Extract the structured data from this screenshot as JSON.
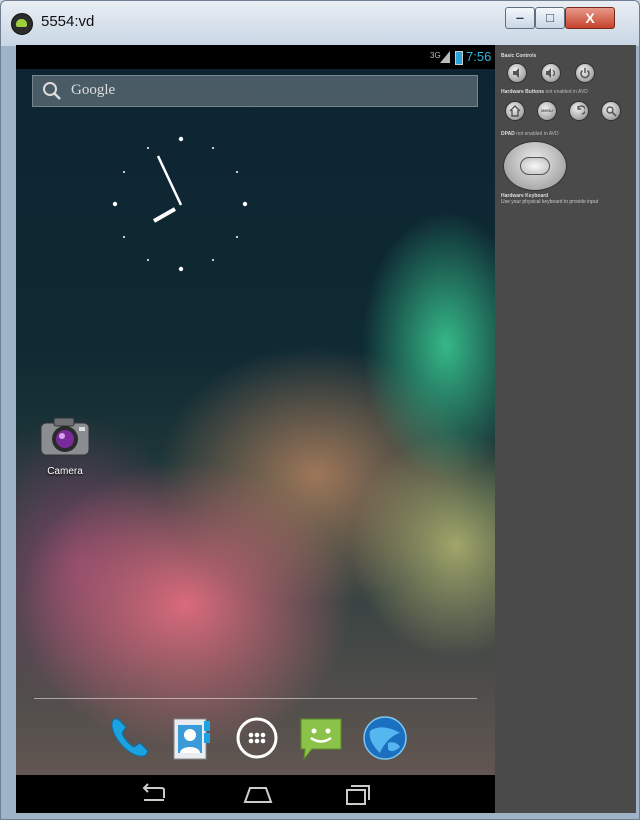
{
  "window": {
    "title": "5554:vd",
    "minimize_glyph": "‒",
    "maximize_glyph": "□",
    "close_glyph": "X"
  },
  "statusbar": {
    "network_type": "3G",
    "time": "7:56"
  },
  "search": {
    "placeholder": "Google"
  },
  "home": {
    "apps": [
      {
        "label": "Camera",
        "icon": "camera-icon"
      }
    ],
    "dock": [
      {
        "icon": "phone-icon"
      },
      {
        "icon": "contacts-icon"
      },
      {
        "icon": "app-drawer-icon"
      },
      {
        "icon": "messaging-icon"
      },
      {
        "icon": "browser-icon"
      }
    ]
  },
  "navbar": {
    "buttons": [
      "back-icon",
      "home-icon",
      "recents-icon"
    ]
  },
  "panel": {
    "basic_controls_title": "Basic Controls",
    "hardware_buttons_title": "Hardware Buttons",
    "hardware_buttons_note": "not enabled in AVD",
    "menu_label": "MENU",
    "dpad_title": "DPAD",
    "dpad_note": "not enabled in AVD",
    "keyboard_title": "Hardware Keyboard",
    "keyboard_note": "Use your physical keyboard to provide input"
  },
  "colors": {
    "status_time": "#33b5e5",
    "panel_background": "#4a4a4a",
    "close_button": "#c5422b"
  }
}
